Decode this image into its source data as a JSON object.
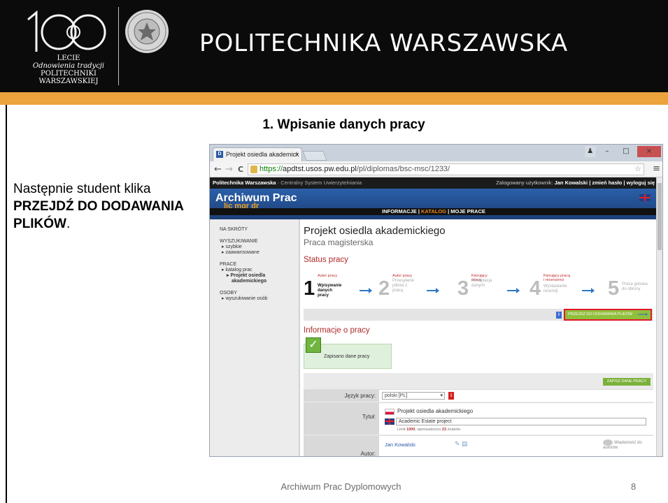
{
  "banner": {
    "logo": {
      "line1": "LECIE",
      "line2": "Odnowienia tradycji",
      "line3": "POLITECHNIKI",
      "line4": "WARSZAWSKIEJ",
      "digits": "100"
    },
    "title": "POLITECHNIKA WARSZAWSKA",
    "seal_icon": "university-seal-icon",
    "accent_color": "#eca23d"
  },
  "slide": {
    "heading": "1. Wpisanie danych pracy",
    "text_before": "Następnie student klika ",
    "text_bold": "PRZEJDŹ DO DODAWANIA PLIKÓW",
    "text_after": ".",
    "footer": "Archiwum Prac Dyplomowych",
    "page_number": "8"
  },
  "browser": {
    "tab_title": "Projekt osiedla akademick",
    "tab_close": "×",
    "url_scheme": "https://",
    "url_host": "apdtst.usos.pw.edu.pl",
    "url_path": "/pl/diplomas/bsc-msc/1233/",
    "window_buttons": {
      "user": "♟",
      "minimize": "–",
      "maximize": "□",
      "close": "×"
    },
    "back": "←",
    "forward": "→",
    "reload": "C",
    "star": "☆",
    "menu": "≡"
  },
  "site": {
    "topbar_left_bold": "Politechnika Warszawska",
    "topbar_left_rest": " - Centralny System Uwierzytelniania",
    "topbar_right_prefix": "Zalogowany użytkownik: ",
    "topbar_user": "Jan Kowalski",
    "topbar_links": " | zmień hasło | wyloguj się",
    "app_title": "Archiwum Prac",
    "app_subtitle": "lic mgr dr",
    "menu": {
      "info": "INFORMACJE",
      "sep1": " | ",
      "katalog": "KATALOG",
      "sep2": " | ",
      "moje": "MOJE PRACE"
    }
  },
  "sidebar": {
    "skroty": "NA SKRÓTY",
    "wyszukiwanie": "WYSZUKIWANIE",
    "szybkie": "▸ szybkie",
    "zaawansowane": "▸ zaawansowane",
    "prace": "PRACE",
    "katalog_prac": "▸ katalog prac",
    "projekt1": "▸ Projekt osiedla",
    "projekt2": "akademickiego",
    "osoby": "OSOBY",
    "wyszukiwanie_osob": "▸ wyszukiwanie osób"
  },
  "thesis": {
    "title": "Projekt osiedla akademickiego",
    "type": "Praca magisterska",
    "status_heading": "Status pracy",
    "info_heading": "Informacje o pracy",
    "saved_message": "Zapisano dane pracy",
    "goto_button": "PRZEJDŹ DO DODAWANIA PLIKÓW",
    "save_button": "ZAPISZ DANE PRACY",
    "steps": [
      {
        "num": "1",
        "role": "Autor pracy",
        "label": "Wpisywanie danych pracy"
      },
      {
        "num": "2",
        "role": "Autor pracy",
        "label": "Przesyłanie plików z pracą"
      },
      {
        "num": "3",
        "role": "Kierujący pracą",
        "label": "Akceptacja danych"
      },
      {
        "num": "4",
        "role": "Kierujący pracą i recenzenci",
        "label": "Wystawianie recenzji"
      },
      {
        "num": "5",
        "role": "",
        "label": "Praca gotowa do obrony"
      }
    ]
  },
  "form": {
    "language_label": "Język pracy:",
    "language_value": "polski [PL]",
    "title_label": "Tytuł:",
    "title_pl": "Projekt osiedla akademickiego",
    "title_en": "Academic Estate project",
    "limit_prefix": "Limit ",
    "limit_max": "1000",
    "limit_mid": ", wprowadzono ",
    "limit_count": "23",
    "limit_suffix": " znaków",
    "author_label": "Autor:",
    "author_name": "Jan Kowalski",
    "message_authors": "Wiadomość do autorów"
  }
}
